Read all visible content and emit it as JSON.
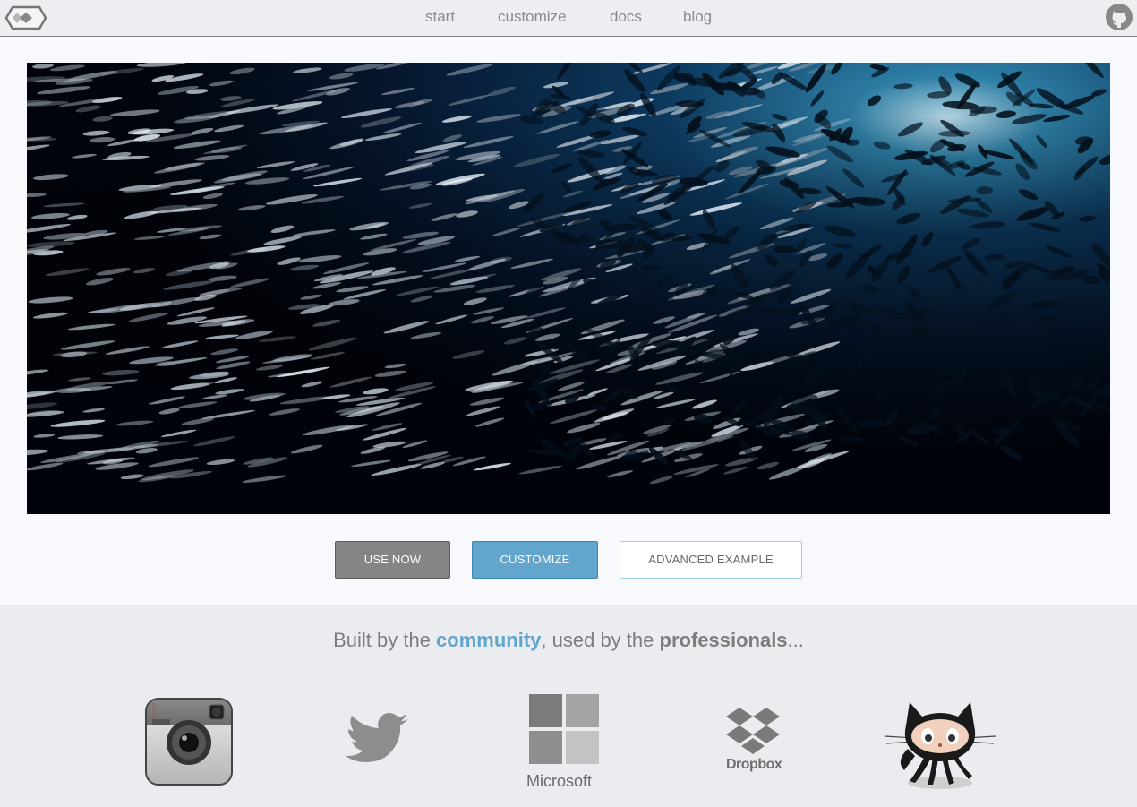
{
  "nav": {
    "links": [
      "start",
      "customize",
      "docs",
      "blog"
    ],
    "logo_icon": "hexagon-logo-icon",
    "github_icon": "github-octocat-icon"
  },
  "hero": {
    "media": "video of a school of sardines underwater",
    "icon": "play-video-icon"
  },
  "buttons": {
    "use_now": "USE NOW",
    "customize": "CUSTOMIZE",
    "advanced": "ADVANCED EXAMPLE"
  },
  "community": {
    "tag_prefix": "Built by the ",
    "tag_community": "community",
    "tag_middle": ", used by the ",
    "tag_professionals": "professionals",
    "tag_suffix": "...",
    "logos": {
      "instagram_icon": "instagram-logo-icon",
      "twitter_icon": "twitter-bird-icon",
      "microsoft_label": "Microsoft",
      "dropbox_label": "Dropbox",
      "github_icon": "github-octocat-icon"
    }
  },
  "colors": {
    "accent": "#62a6cd",
    "use_now_bg": "#858585",
    "nav_bg": "#eceef1",
    "community_bg": "#ebecef"
  }
}
